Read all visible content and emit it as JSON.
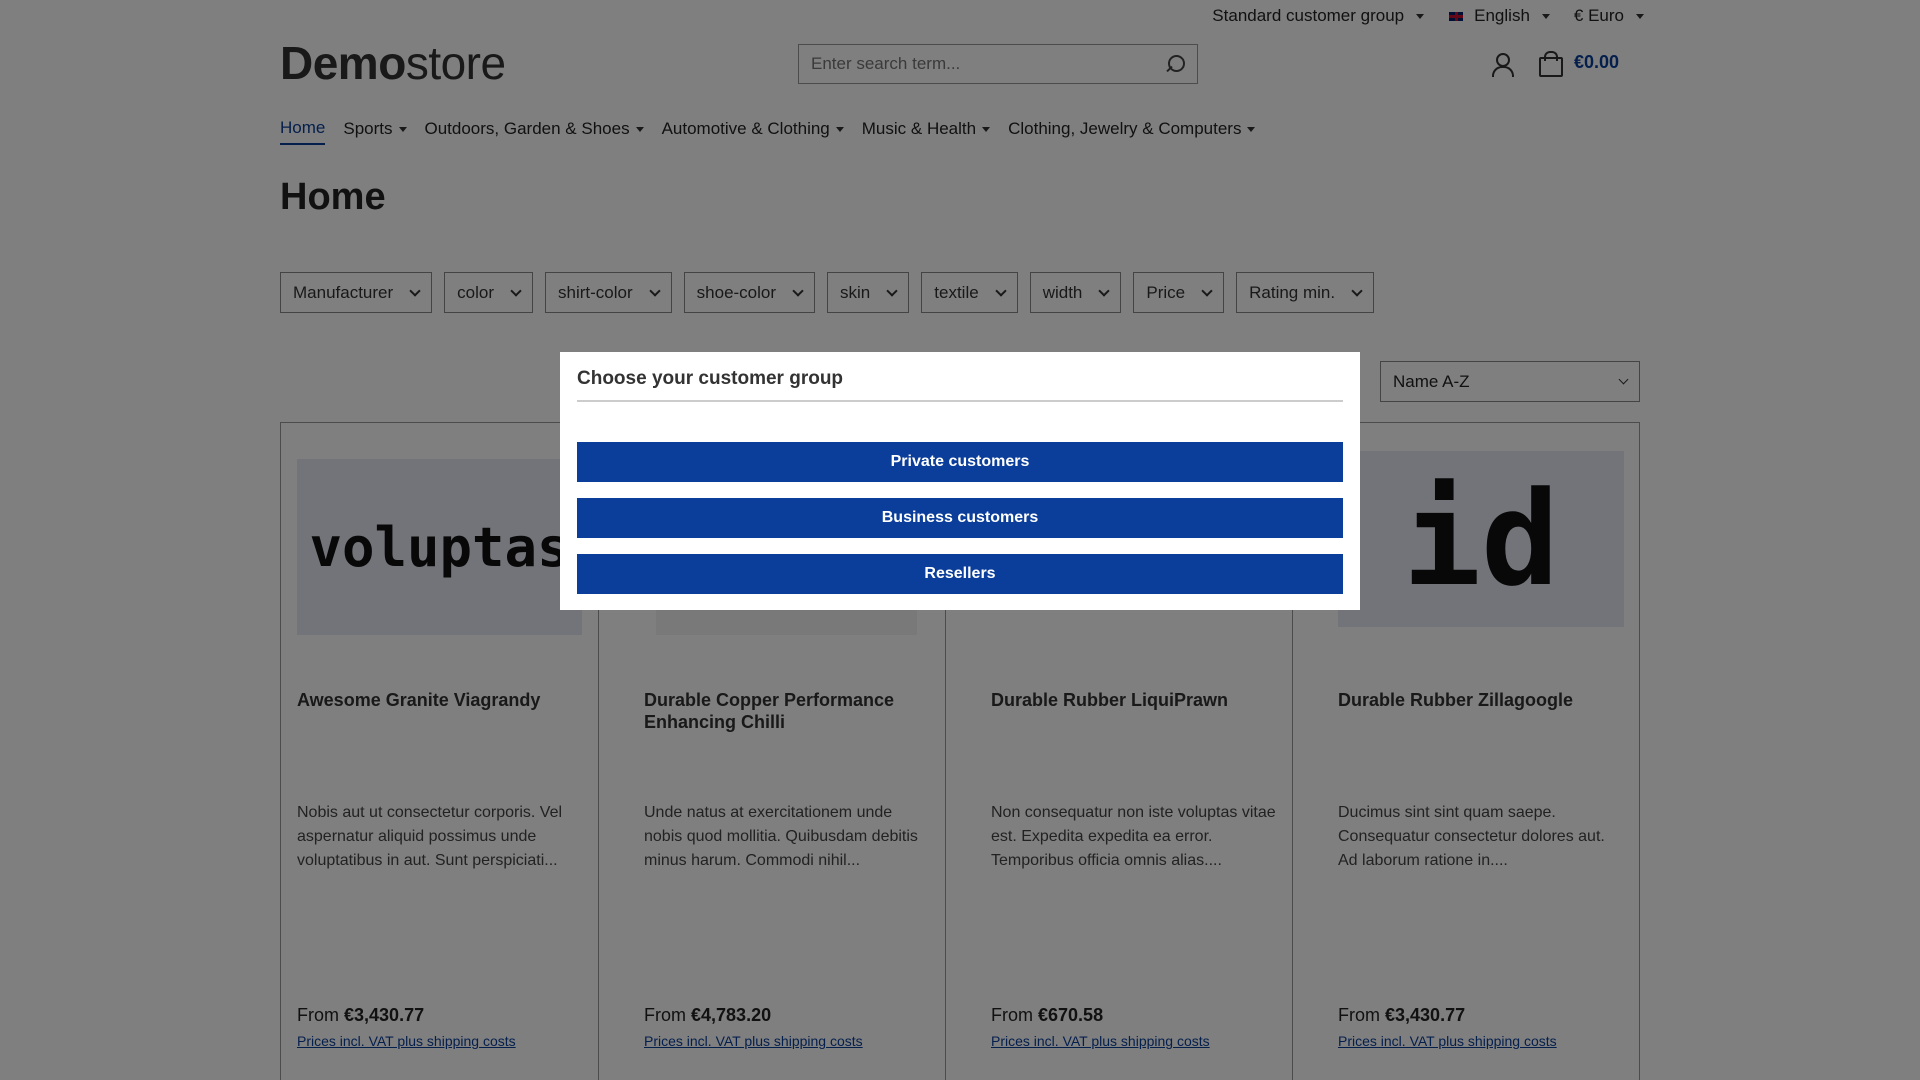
{
  "topbar": {
    "customer_group": "Standard customer group",
    "language": "English",
    "currency": "€ Euro"
  },
  "header": {
    "logo_bold": "Demo",
    "logo_light": "store",
    "search_placeholder": "Enter search term...",
    "cart_total": "€0.00"
  },
  "nav": {
    "items": [
      {
        "label": "Home",
        "active": true
      },
      {
        "label": "Sports"
      },
      {
        "label": "Outdoors, Garden & Shoes"
      },
      {
        "label": "Automotive & Clothing"
      },
      {
        "label": "Music & Health"
      },
      {
        "label": "Clothing, Jewelry & Computers"
      }
    ]
  },
  "page": {
    "title": "Home"
  },
  "filters": [
    "Manufacturer",
    "color",
    "shirt-color",
    "shoe-color",
    "skin",
    "textile",
    "width",
    "Price",
    "Rating min."
  ],
  "sort": {
    "selected": "Name A-Z"
  },
  "products": [
    {
      "thumb_text": "voluptas",
      "name": "Awesome Granite Viagrandy",
      "desc": "Nobis aut ut consectetur corporis. Vel aspernatur aliquid possimus unde voluptatibus in aut. Sunt perspiciati...",
      "price_prefix": "From",
      "price": "€3,430.77",
      "vat": "Prices incl. VAT plus shipping costs"
    },
    {
      "thumb_text": "",
      "name": "Durable Copper Performance Enhancing Chilli",
      "desc": "Unde natus at exercitationem unde nobis quod mollitia. Quibusdam debitis minus harum. Commodi nihil...",
      "price_prefix": "From",
      "price": "€4,783.20",
      "vat": "Prices incl. VAT plus shipping costs"
    },
    {
      "thumb_text": "",
      "name": "Durable Rubber LiquiPrawn",
      "desc": "Non consequatur non iste voluptas vitae est. Expedita expedita ea error. Temporibus officia omnis alias....",
      "price_prefix": "From",
      "price": "€670.58",
      "vat": "Prices incl. VAT plus shipping costs"
    },
    {
      "thumb_text": "id",
      "name": "Durable Rubber Zillagoogle",
      "desc": "Ducimus sint sint quam saepe. Consequatur consectetur dolores aut. Ad laborum ratione in....",
      "price_prefix": "From",
      "price": "€3,430.77",
      "vat": "Prices incl. VAT plus shipping costs"
    }
  ],
  "modal": {
    "title": "Choose your customer group",
    "buttons": [
      "Private customers",
      "Business customers",
      "Resellers"
    ]
  },
  "colors": {
    "accent": "#0b3e9a",
    "overlay": "rgba(0,0,0,0.5)"
  }
}
